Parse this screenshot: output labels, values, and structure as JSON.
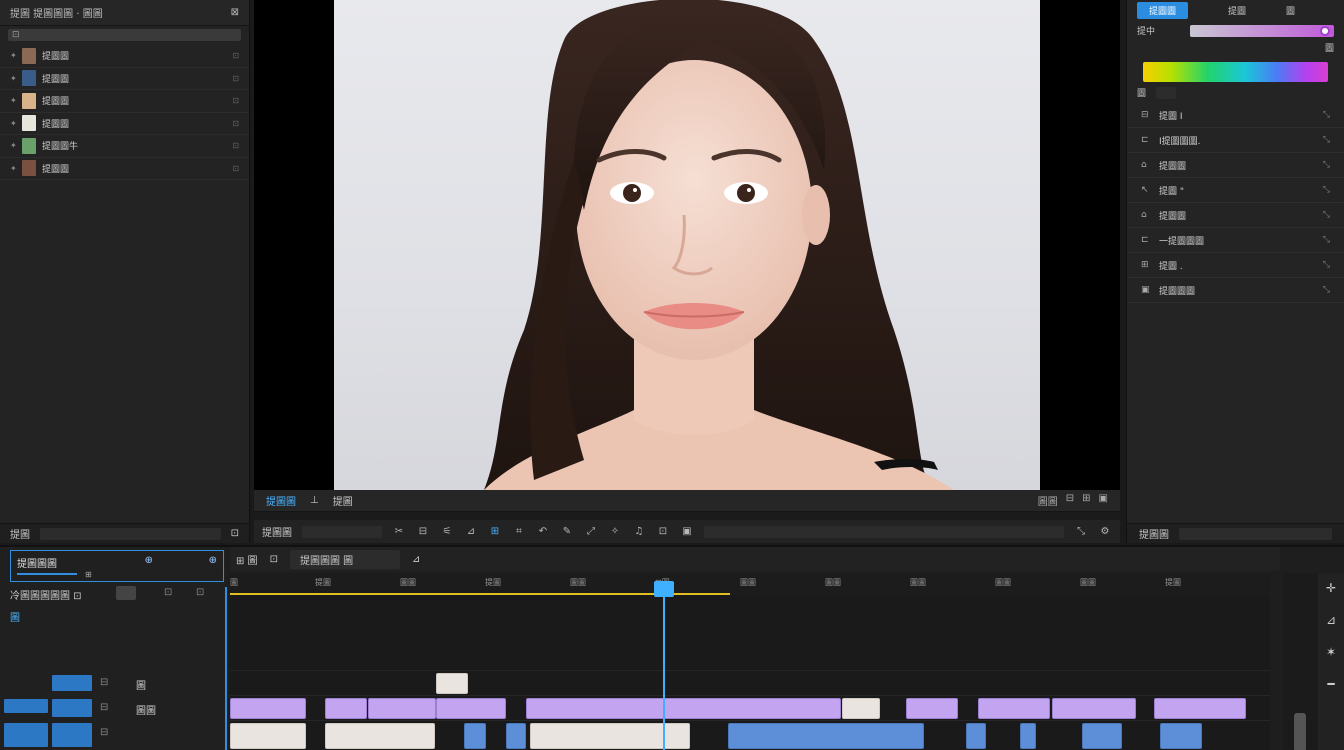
{
  "left_panel": {
    "header_title": "提圖 提圖圖圖 · 圖圖",
    "header_close": "⊠",
    "search_value": "",
    "assets": [
      {
        "name": "提圖圖",
        "count": "⊡",
        "thumb_color": "#8b6a55"
      },
      {
        "name": "提圖圖",
        "count": "⊡",
        "thumb_color": "#3a5c8a"
      },
      {
        "name": "提圖圖",
        "count": "⊡",
        "thumb_color": "#d9b48a"
      },
      {
        "name": "提圖圖",
        "count": "⊡",
        "thumb_color": "#e6e6df"
      },
      {
        "name": "提圖圖牛",
        "count": "⊡",
        "thumb_color": "#6aa06a"
      },
      {
        "name": "提圖圖",
        "count": "⊡",
        "thumb_color": "#7a5040"
      }
    ],
    "footer_label": "提圖"
  },
  "viewer": {
    "tabs": [
      "提圖圖",
      "⊥",
      "提圖"
    ],
    "right_label": "圖圖"
  },
  "transport": {
    "left_label": "提圖圖"
  },
  "right_panel": {
    "top_tabs": [
      "提圖圖",
      "提圖",
      "圖"
    ],
    "color_label": "提中",
    "color_value": "圖",
    "sub_label": "圖",
    "props": [
      {
        "icon": "⊟",
        "label": "提圖 I"
      },
      {
        "icon": "⊏",
        "label": "I提圖圖圖."
      },
      {
        "icon": "⌂",
        "label": "提圖圖"
      },
      {
        "icon": "↖",
        "label": "提圖 \""
      },
      {
        "icon": "⌂",
        "label": "提圖圖"
      },
      {
        "icon": "⊏",
        "label": "一提圖圖圖"
      },
      {
        "icon": "⊞",
        "label": "提圖 ."
      },
      {
        "icon": "▣",
        "label": "提圖圖圖"
      }
    ],
    "footer_label": "提圖圖"
  },
  "timeline": {
    "sequence_name": "提圖圖圖",
    "sequence_sub": "⊞",
    "track_info": "冷圖圖圖圖圖 ⊡",
    "track_tag": "圖",
    "toolbar_items": [
      "⊞ 圖",
      "⊡",
      "提圖圖圖 圖"
    ],
    "ruler_ticks": [
      "圖",
      "提圖",
      "圖圖",
      "提圖",
      "圖圖",
      "⊡圖",
      "圖圖",
      "圖圖",
      "圖圖",
      "圖圖",
      "圖圖",
      "提圖"
    ],
    "video_track_label": "圖",
    "audio_track_label": "圖圖",
    "colors": {
      "accent": "#2f8fe0",
      "playhead": "#3fb0ff",
      "work_area": "#e0c020",
      "clip_purple": "#c2a4f0",
      "clip_blue": "#5c8fd8"
    }
  }
}
